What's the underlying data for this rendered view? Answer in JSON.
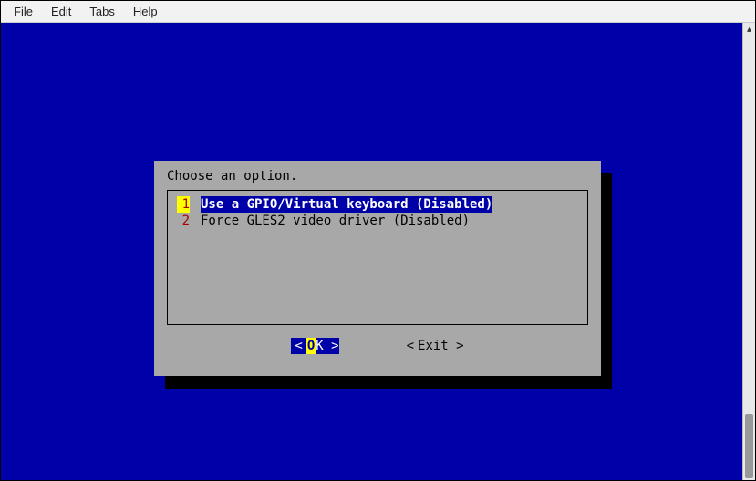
{
  "menubar": {
    "items": [
      "File",
      "Edit",
      "Tabs",
      "Help"
    ]
  },
  "dialog": {
    "title": "Choose an option.",
    "options": [
      {
        "num": "1",
        "label": "Use a GPIO/Virtual keyboard (Disabled)",
        "selected": true
      },
      {
        "num": "2",
        "label": "Force GLES2 video driver (Disabled)",
        "selected": false
      }
    ],
    "buttons": {
      "ok": {
        "left": "<  ",
        "hot": "O",
        "rest": "K  >",
        "selected": true
      },
      "exit": {
        "left": "< ",
        "hot": "E",
        "rest": "xit >",
        "selected": false
      }
    }
  }
}
